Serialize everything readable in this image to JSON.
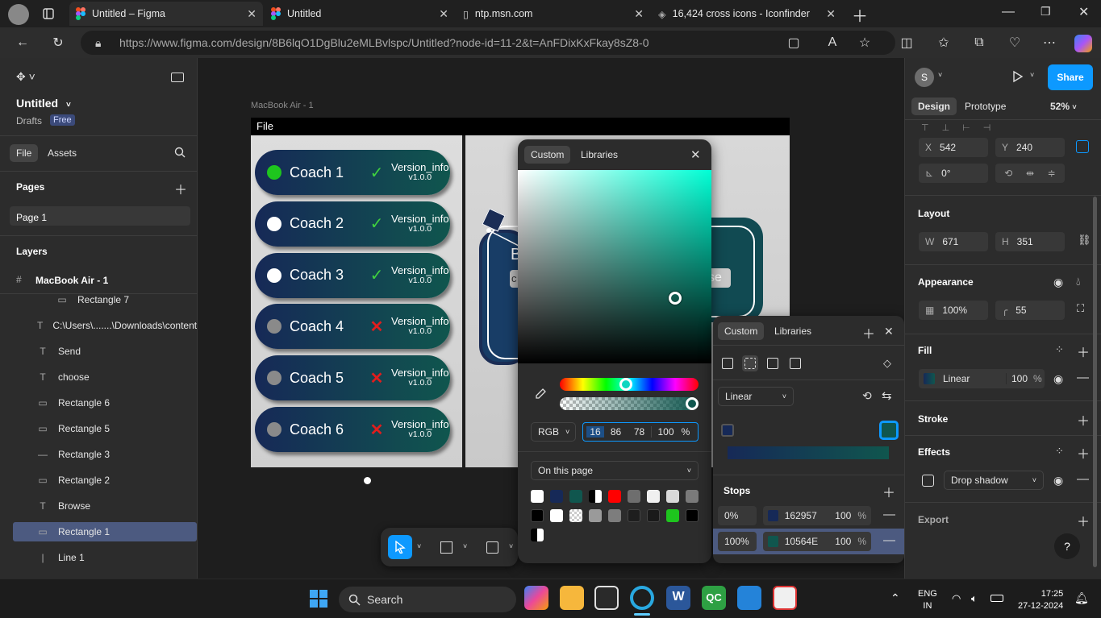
{
  "browser": {
    "tabs": [
      {
        "title": "Untitled – Figma",
        "active": true
      },
      {
        "title": "Untitled",
        "active": false
      },
      {
        "title": "ntp.msn.com",
        "active": false
      },
      {
        "title": "16,424 cross icons - Iconfinder",
        "active": false
      }
    ],
    "url": "https://www.figma.com/design/8B6lqO1DgBlu2eMLBvlspc/Untitled?node-id=11-2&t=AnFDixKxFkay8sZ8-0"
  },
  "left": {
    "file_name": "Untitled",
    "drafts": "Drafts",
    "plan_badge": "Free",
    "tab_file": "File",
    "tab_assets": "Assets",
    "pages_title": "Pages",
    "page1": "Page 1",
    "layers_title": "Layers",
    "frame": "MacBook Air - 1",
    "layers": [
      {
        "name": "Rectangle 7",
        "icon": "rect-line-icon"
      },
      {
        "name": "C:\\Users\\.......\\Downloads\\content",
        "icon": "text-icon"
      },
      {
        "name": "Send",
        "icon": "text-icon"
      },
      {
        "name": "choose",
        "icon": "text-icon"
      },
      {
        "name": "Rectangle 6",
        "icon": "rect-icon"
      },
      {
        "name": "Rectangle 5",
        "icon": "rect-icon"
      },
      {
        "name": "Rectangle 3",
        "icon": "line-icon"
      },
      {
        "name": "Rectangle 2",
        "icon": "rect-icon"
      },
      {
        "name": "Browse",
        "icon": "text-icon"
      },
      {
        "name": "Rectangle 1",
        "icon": "rect-icon",
        "selected": true
      },
      {
        "name": "Line 1",
        "icon": "vline-icon"
      }
    ]
  },
  "canvas": {
    "frame_label": "MacBook Air - 1",
    "file_menu": "File",
    "coaches": [
      {
        "name": "Coach 1",
        "status": "check",
        "dot": "#1ec51e",
        "ver1": "Version_info",
        "ver2": "v1.0.0"
      },
      {
        "name": "Coach 2",
        "status": "check",
        "dot": "#ffffff",
        "ver1": "Version_info",
        "ver2": "v1.0.0"
      },
      {
        "name": "Coach 3",
        "status": "check",
        "dot": "#ffffff",
        "ver1": "Version_info",
        "ver2": "v1.0.0"
      },
      {
        "name": "Coach 4",
        "status": "cross",
        "dot": "#8a8a8a",
        "ver1": "Version_info",
        "ver2": "v1.0.0"
      },
      {
        "name": "Coach 5",
        "status": "cross",
        "dot": "#8a8a8a",
        "ver1": "Version_info",
        "ver2": "v1.0.0"
      },
      {
        "name": "Coach 6",
        "status": "cross",
        "dot": "#8a8a8a",
        "ver1": "Version_info",
        "ver2": "v1.0.0"
      }
    ],
    "card_text_b": "B",
    "card_btn_text": "se",
    "card_left_text": "c"
  },
  "picker": {
    "tab_custom": "Custom",
    "tab_libraries": "Libraries",
    "mode": "RGB",
    "r": "16",
    "g": "86",
    "b": "78",
    "a": "100",
    "pct": "%",
    "swatch_source": "On this page",
    "swatches": [
      "#ffffff",
      "#162957",
      "#10564e",
      "#split",
      "#ff0000",
      "#6e6e6e",
      "#f0f0f0",
      "#d9d9d9",
      "#7a7a7a",
      "#000000",
      "#ffffff",
      "#checker",
      "#9a9a9a",
      "#7d7d7d",
      "#1e1e1e",
      "#1a1a1a",
      "#1ec51e",
      "#000000",
      "#split"
    ]
  },
  "gradient_panel": {
    "tab_custom": "Custom",
    "tab_libraries": "Libraries",
    "type": "Linear",
    "stops_title": "Stops",
    "stops": [
      {
        "pos": "0%",
        "hex": "162957",
        "opacity": "100",
        "pct": "%",
        "color": "#162957"
      },
      {
        "pos": "100%",
        "hex": "10564E",
        "opacity": "100",
        "pct": "%",
        "color": "#10564E"
      }
    ]
  },
  "right": {
    "avatar": "S",
    "share": "Share",
    "tab_design": "Design",
    "tab_prototype": "Prototype",
    "zoom": "52%",
    "x_label": "X",
    "x": "542",
    "y_label": "Y",
    "y": "240",
    "rotation": "0°",
    "layout_title": "Layout",
    "w_label": "W",
    "w": "671",
    "h_label": "H",
    "h": "351",
    "appearance_title": "Appearance",
    "opacity": "100%",
    "radius": "55",
    "fill_title": "Fill",
    "fill_type": "Linear",
    "fill_opacity": "100",
    "fill_pct": "%",
    "stroke_title": "Stroke",
    "effects_title": "Effects",
    "effect": "Drop shadow",
    "export_title": "Export",
    "help": "?"
  },
  "taskbar": {
    "search": "Search",
    "lang1": "ENG",
    "lang2": "IN",
    "time": "17:25",
    "date": "27-12-2024"
  }
}
